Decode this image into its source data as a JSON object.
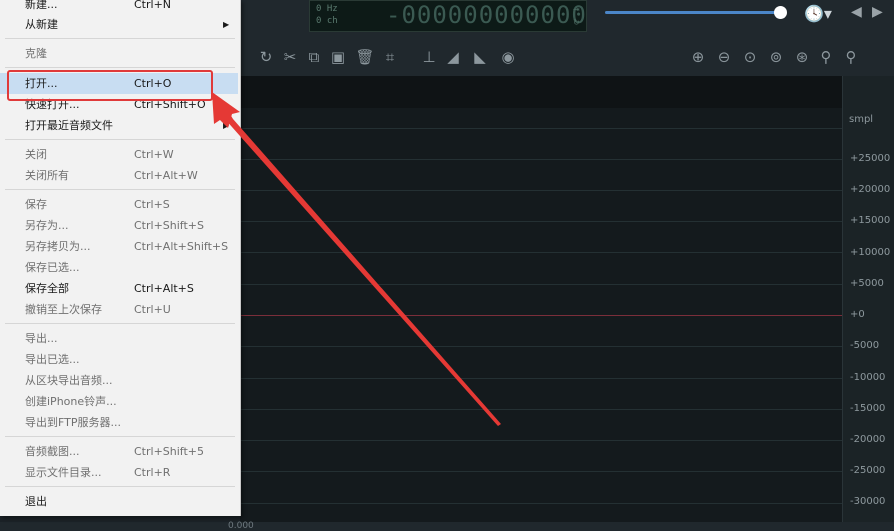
{
  "menu": {
    "items": [
      {
        "label": "新建...",
        "shortcut": "Ctrl+N",
        "state": "enabled"
      },
      {
        "label": "从新建",
        "shortcut": "",
        "state": "enabled",
        "submenu": true
      },
      {
        "label": "克隆",
        "shortcut": "",
        "state": "disabled"
      },
      {
        "label": "打开...",
        "shortcut": "Ctrl+O",
        "state": "active"
      },
      {
        "label": "快速打开...",
        "shortcut": "Ctrl+Shift+O",
        "state": "enabled"
      },
      {
        "label": "打开最近音频文件",
        "shortcut": "",
        "state": "enabled",
        "submenu": true
      },
      {
        "label": "关闭",
        "shortcut": "Ctrl+W",
        "state": "disabled"
      },
      {
        "label": "关闭所有",
        "shortcut": "Ctrl+Alt+W",
        "state": "disabled"
      },
      {
        "label": "保存",
        "shortcut": "Ctrl+S",
        "state": "disabled"
      },
      {
        "label": "另存为...",
        "shortcut": "Ctrl+Shift+S",
        "state": "disabled"
      },
      {
        "label": "另存拷贝为...",
        "shortcut": "Ctrl+Alt+Shift+S",
        "state": "disabled"
      },
      {
        "label": "保存已选...",
        "shortcut": "",
        "state": "disabled"
      },
      {
        "label": "保存全部",
        "shortcut": "Ctrl+Alt+S",
        "state": "enabled"
      },
      {
        "label": "撤销至上次保存",
        "shortcut": "Ctrl+U",
        "state": "disabled"
      },
      {
        "label": "导出...",
        "shortcut": "",
        "state": "disabled"
      },
      {
        "label": "导出已选...",
        "shortcut": "",
        "state": "disabled"
      },
      {
        "label": "从区块导出音频...",
        "shortcut": "",
        "state": "disabled"
      },
      {
        "label": "创建iPhone铃声...",
        "shortcut": "",
        "state": "disabled"
      },
      {
        "label": "导出到FTP服务器...",
        "shortcut": "",
        "state": "disabled"
      },
      {
        "label": "音频截图...",
        "shortcut": "Ctrl+Shift+5",
        "state": "disabled"
      },
      {
        "label": "显示文件目录...",
        "shortcut": "Ctrl+R",
        "state": "disabled"
      },
      {
        "label": "退出",
        "shortcut": "",
        "state": "enabled"
      }
    ]
  },
  "readout": {
    "freq": "0 Hz",
    "channels": "0 ch",
    "counter": "-000000000000"
  },
  "ruler": {
    "unit": "smpl",
    "labels": [
      "+25000",
      "+20000",
      "+15000",
      "+10000",
      "+5000",
      "+0",
      "-5000",
      "-10000",
      "-15000",
      "-20000",
      "-25000",
      "-30000"
    ]
  },
  "bottom": {
    "time": "0.000"
  },
  "icons": {
    "history": "history-icon",
    "back": "arrow-left-icon",
    "forward": "arrow-right-icon"
  },
  "colors": {
    "highlight": "#e03a3a",
    "annotation_arrow": "#e53935",
    "zero_line": "#7b2e3a",
    "volume": "#4b86c8"
  }
}
